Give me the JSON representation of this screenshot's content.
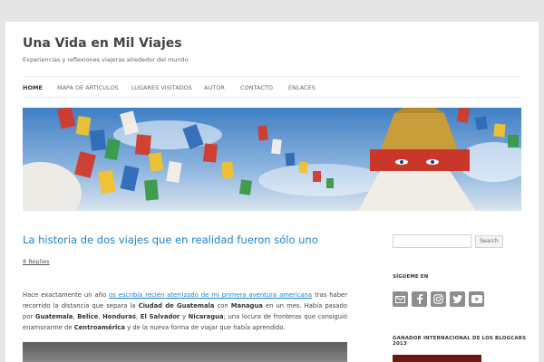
{
  "site": {
    "title": "Una Vida en Mil Viajes",
    "description": "Experiencias y reflexiones viajeras alrededor del mundo"
  },
  "nav": {
    "items": [
      {
        "label": "HOME",
        "active": true
      },
      {
        "label": "MAPA DE ARTÍCULOS",
        "active": false
      },
      {
        "label": "LUGARES VISITADOS",
        "active": false
      },
      {
        "label": "AUTOR",
        "active": false
      },
      {
        "label": "CONTACTO",
        "active": false
      },
      {
        "label": "ENLACES",
        "active": false
      }
    ]
  },
  "post": {
    "title": "La historia de dos viajes que en realidad fueron sólo uno",
    "replies": "8 Replies",
    "p1": "Hace exactamente un año ",
    "link": "os escribía recién aterrizado de mi primera aventura americana",
    "p2": " tras haber recorrido la distancia que separa la ",
    "b1": "Ciudad de Guatemala",
    "p3": " con ",
    "b2": "Managua",
    "p4": " en un mes. Había pasado por ",
    "b3": "Guatemala",
    "s1": ", ",
    "b4": "Belice",
    "s2": ", ",
    "b5": "Honduras",
    "s3": ", ",
    "b6": "El Salvador",
    "s4": " y ",
    "b7": "Nicaragua",
    "p5": "; una locura de fronteras que consiguió enamorarme de ",
    "b8": "Centroamérica",
    "p6": " y de la nueva forma de viajar que había aprendido."
  },
  "sidebar": {
    "search_button": "Search",
    "follow_title": "SÍGUEME EN",
    "social": [
      "email-icon",
      "facebook-icon",
      "instagram-icon",
      "twitter-icon",
      "youtube-icon"
    ],
    "award_title": "GANADOR INTERNACIONAL DE LOS BLOGCARS 2013"
  },
  "colors": {
    "link": "#1982d1",
    "background": "#e6e6e6"
  }
}
